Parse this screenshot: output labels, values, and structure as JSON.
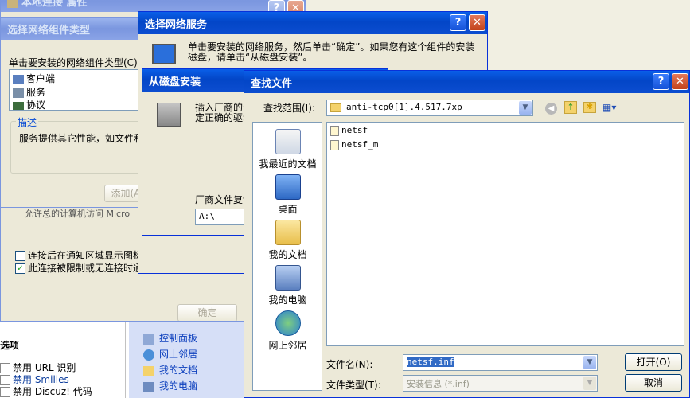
{
  "props_window": {
    "title": "本地连接 属性",
    "partial_text": "允许总的计算机访问 Micro",
    "notify_label": "连接后在通知区域显示图标",
    "limited_label": "此连接被限制或无连接时通",
    "ok_label": "确定"
  },
  "component_type_window": {
    "title": "选择网络组件类型",
    "instruction": "单击要安装的网络组件类型(C):",
    "items": [
      "客户端",
      "服务",
      "协议"
    ],
    "desc_legend": "描述",
    "desc_text": "服务提供其它性能，如文件和",
    "add_label": "添加(A)..."
  },
  "network_service_window": {
    "title": "选择网络服务",
    "instruction": "单击要安装的网络服务，然后单击“确定”。如果您有这个组件的安装磁盘，请单击“从磁盘安装”。"
  },
  "disk_install_window": {
    "title": "从磁盘安装",
    "instruction": "插入厂商的安装磁盘，然后确定已在下面选定正确的驱动器。",
    "copy_label": "厂商文件复制来源:",
    "copy_value": "A:\\"
  },
  "find_file_dialog": {
    "title": "查找文件",
    "lookin_label": "查找范围(I):",
    "lookin_value": "anti-tcp0[1].4.517.7xp",
    "places": [
      "我最近的文档",
      "桌面",
      "我的文档",
      "我的电脑",
      "网上邻居"
    ],
    "files": [
      "netsf",
      "netsf_m"
    ],
    "filename_label": "文件名(N):",
    "filename_value": "netsf.inf",
    "filetype_label": "文件类型(T):",
    "filetype_value": "安装信息 (*.inf)",
    "open_label": "打开(O)",
    "cancel_label": "取消"
  },
  "background": {
    "options_heading": "选项",
    "options": [
      "禁用 URL 识别",
      "禁用 Smilies",
      "禁用 Discuz! 代码"
    ],
    "links": [
      "控制面板",
      "网上邻居",
      "我的文档",
      "我的电脑"
    ]
  },
  "colors": {
    "title_active": "#0a5fe8",
    "window_face": "#ece9d8",
    "selection": "#316ac5"
  }
}
